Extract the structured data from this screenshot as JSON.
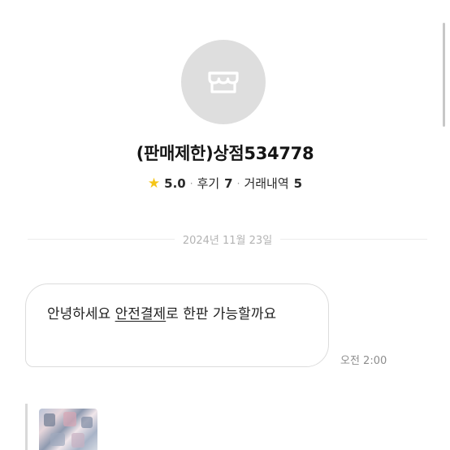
{
  "shop": {
    "name": "(판매제한)상점534778",
    "avatar_icon": "storefront-icon",
    "rating": "5.0",
    "reviews_label": "후기",
    "reviews_count": "7",
    "trades_label": "거래내역",
    "trades_count": "5"
  },
  "chat": {
    "date_divider": "2024년 11월 23일",
    "message": {
      "part1": "안녕하세요 ",
      "link": "안전결제",
      "part2": "로 한판 가능할까요",
      "time": "오전 2:00"
    }
  },
  "colors": {
    "star": "#f5c518",
    "avatar_bg": "#dedede",
    "bubble_border": "#dcdcdc"
  }
}
